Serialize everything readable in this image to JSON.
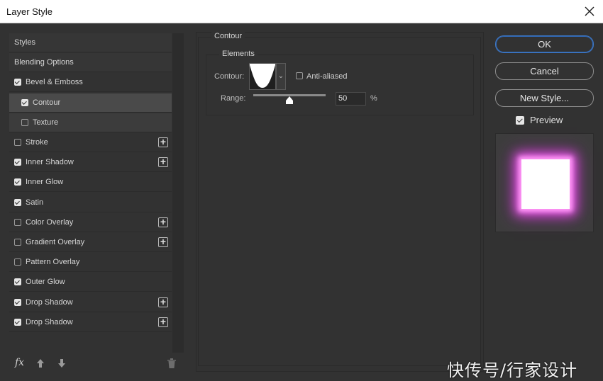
{
  "window": {
    "title": "Layer Style"
  },
  "sidebar": {
    "items": [
      {
        "label": "Styles",
        "type": "header"
      },
      {
        "label": "Blending Options",
        "type": "header"
      },
      {
        "label": "Bevel & Emboss",
        "checked": true,
        "plus": false
      },
      {
        "label": "Contour",
        "checked": true,
        "plus": false,
        "selected": true,
        "indent": true
      },
      {
        "label": "Texture",
        "checked": false,
        "plus": false,
        "indent": true
      },
      {
        "label": "Stroke",
        "checked": false,
        "plus": true
      },
      {
        "label": "Inner Shadow",
        "checked": true,
        "plus": true
      },
      {
        "label": "Inner Glow",
        "checked": true,
        "plus": false
      },
      {
        "label": "Satin",
        "checked": true,
        "plus": false
      },
      {
        "label": "Color Overlay",
        "checked": false,
        "plus": true
      },
      {
        "label": "Gradient Overlay",
        "checked": false,
        "plus": true
      },
      {
        "label": "Pattern Overlay",
        "checked": false,
        "plus": false
      },
      {
        "label": "Outer Glow",
        "checked": true,
        "plus": false
      },
      {
        "label": "Drop Shadow",
        "checked": true,
        "plus": true
      },
      {
        "label": "Drop Shadow",
        "checked": true,
        "plus": true
      }
    ],
    "fx_label": "fx",
    "plus_symbol": "+"
  },
  "panel": {
    "group_title": "Contour",
    "subgroup_title": "Elements",
    "contour_label": "Contour:",
    "anti_aliased_label": "Anti-aliased",
    "anti_aliased_checked": false,
    "range_label": "Range:",
    "range_value": "50",
    "range_unit": "%",
    "range_fraction": 0.5
  },
  "buttons": {
    "ok": "OK",
    "cancel": "Cancel",
    "new_style": "New Style..."
  },
  "preview": {
    "label": "Preview",
    "checked": true,
    "glow_color": "#e35ae0"
  },
  "watermark": "快传号/行家设计"
}
